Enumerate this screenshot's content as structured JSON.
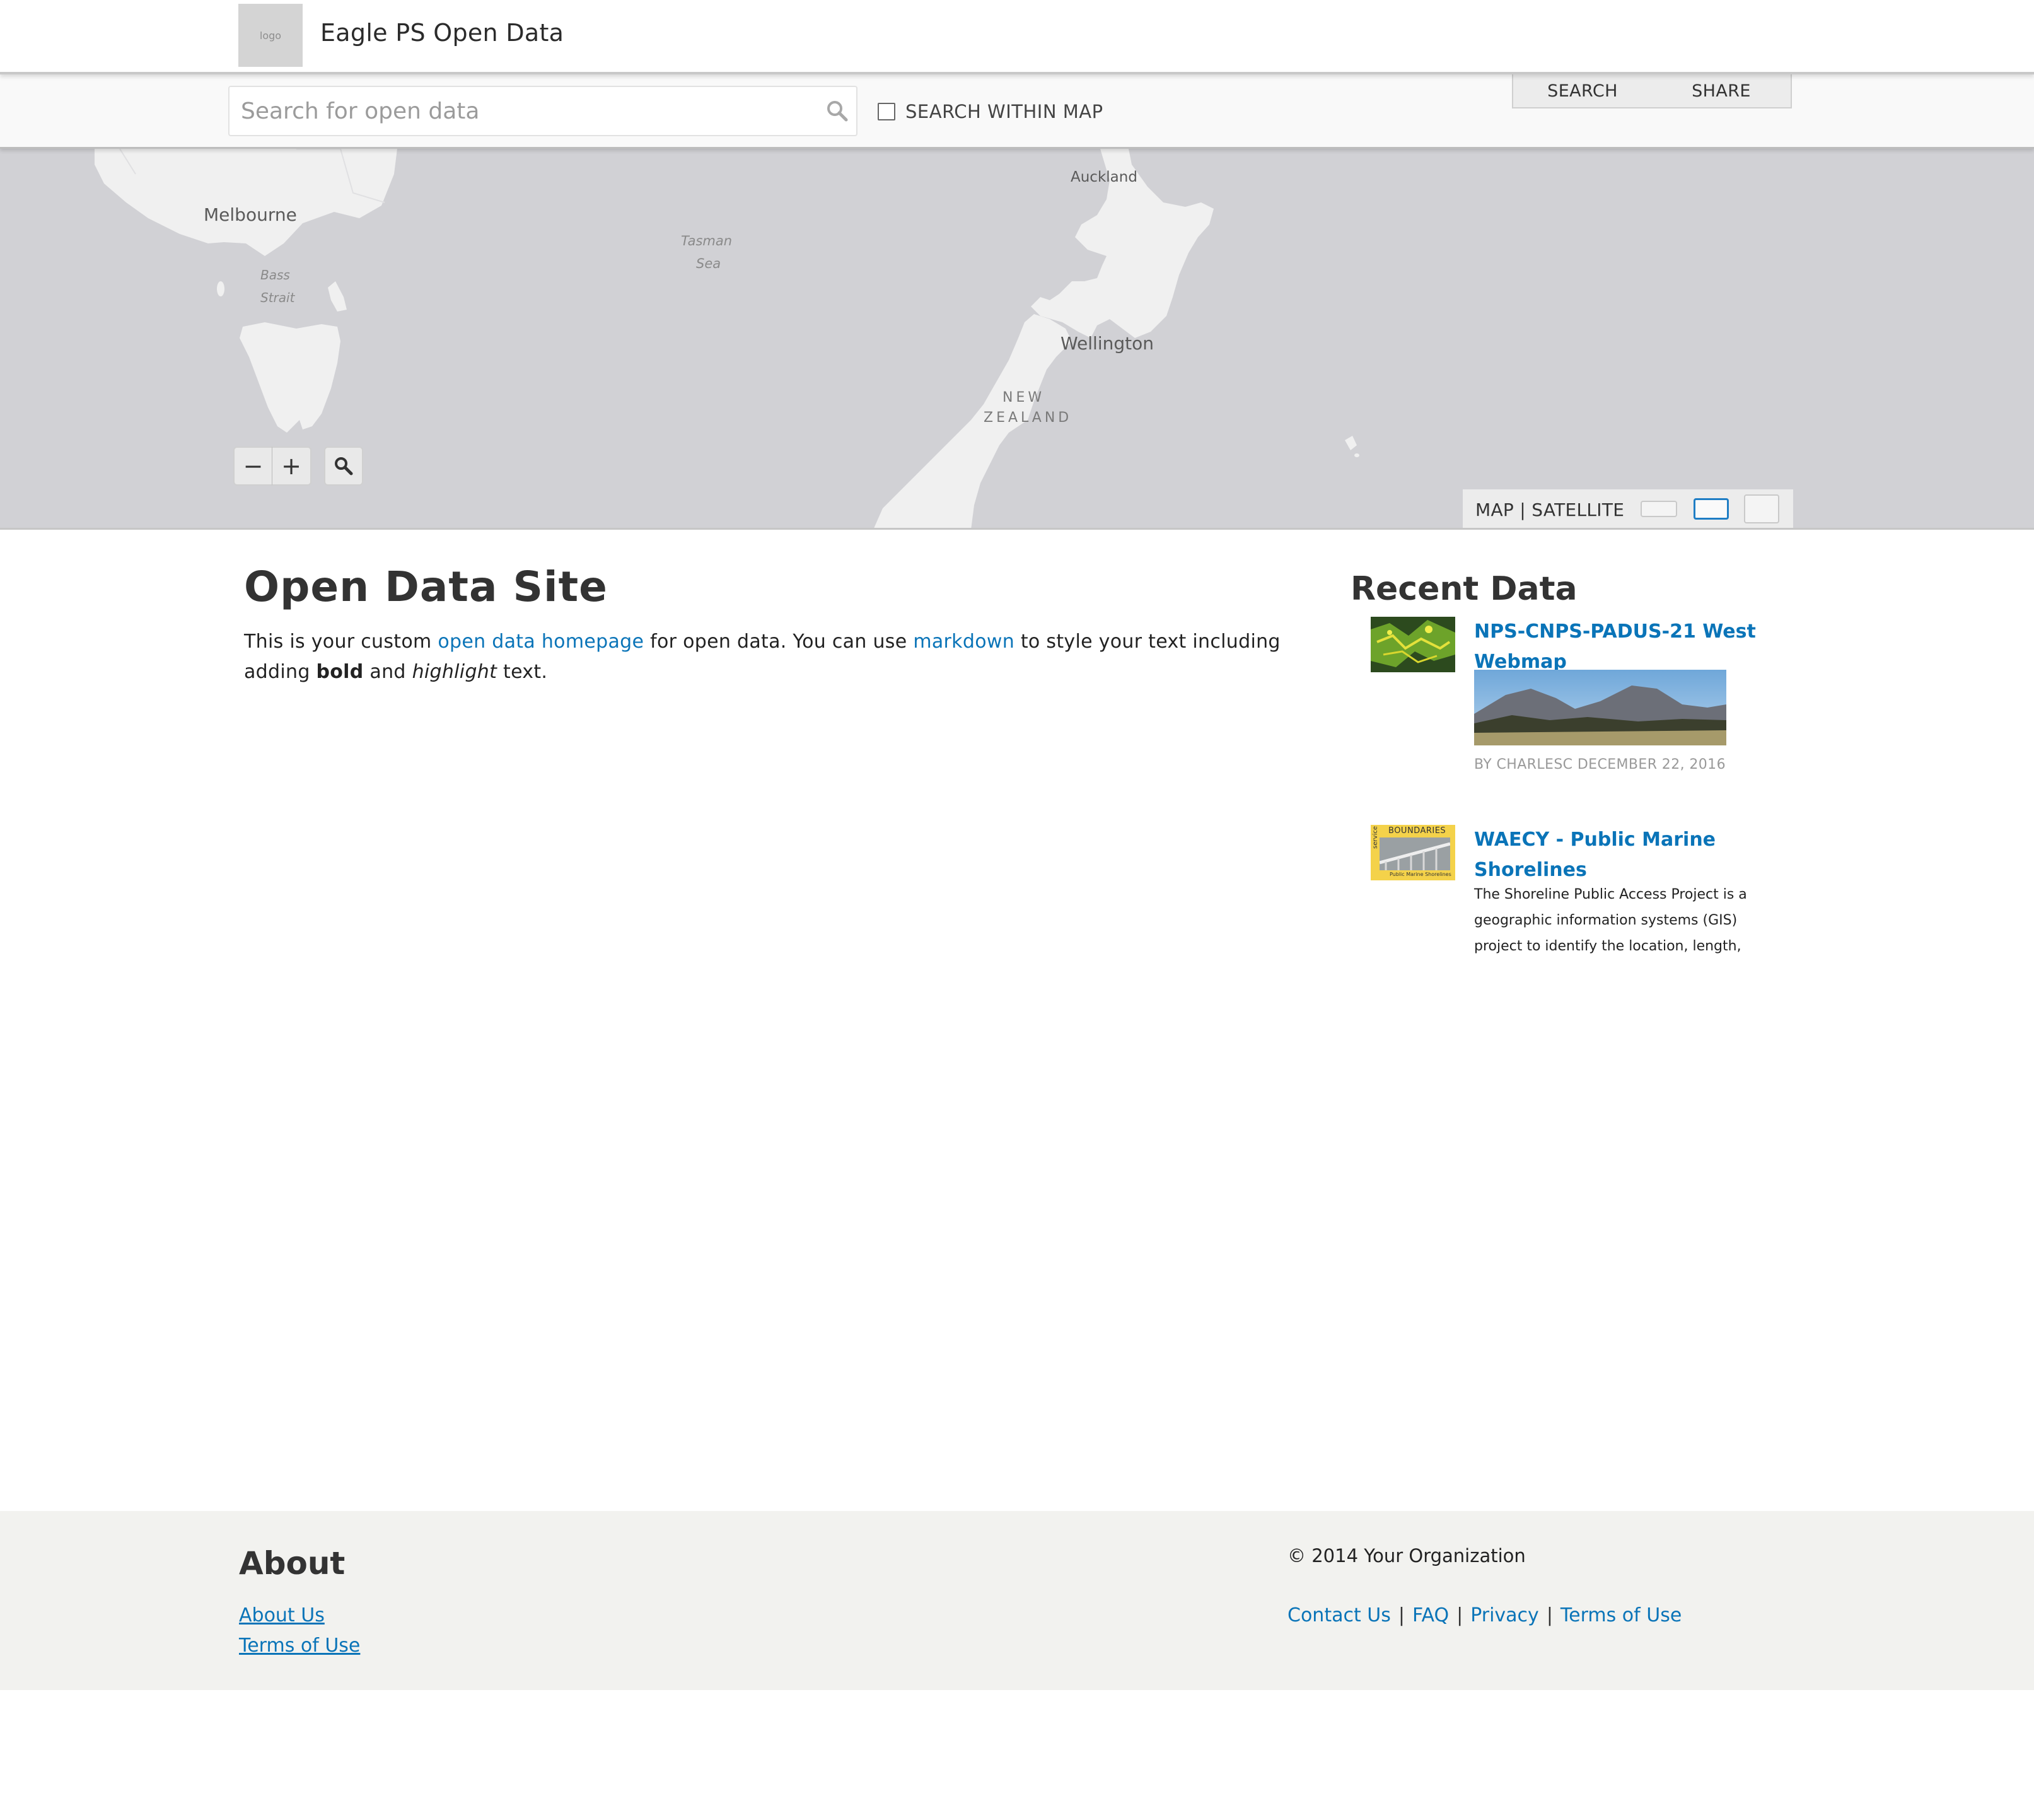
{
  "header": {
    "logo_text": "logo",
    "site_title": "Eagle PS Open Data"
  },
  "search": {
    "placeholder": "Search for open data",
    "within_map_label": "SEARCH WITHIN MAP",
    "tabs": [
      "SEARCH",
      "SHARE"
    ]
  },
  "map": {
    "labels": {
      "melbourne": "Melbourne",
      "bass_strait_1": "Bass",
      "bass_strait_2": "Strait",
      "tasman_1": "Tasman",
      "tasman_2": "Sea",
      "auckland": "Auckland",
      "wellington": "Wellington",
      "nz_1": "NEW",
      "nz_2": "ZEALAND"
    },
    "zoom_out": "−",
    "zoom_in": "+",
    "basemap_label": "MAP | SATELLITE",
    "colors": {
      "water": "#d1d1d5",
      "land": "#f0f0f0"
    }
  },
  "main": {
    "title": "Open Data Site",
    "intro": {
      "part1": "This is your custom ",
      "link1": "open data homepage",
      "part2": " for open data. You can use ",
      "link2": "markdown",
      "part3": " to style your text including adding ",
      "bold": "bold",
      "part4": " and ",
      "italic": "highlight",
      "part5": " text."
    }
  },
  "recent": {
    "title": "Recent Data",
    "items": [
      {
        "title": "NPS-CNPS-PADUS-21 West Webmap",
        "byline": "BY CHARLESC DECEMBER 22, 2016"
      },
      {
        "title": "WAECY - Public Marine Shorelines",
        "thumb_text": "BOUNDARIES",
        "thumb_side": "service",
        "thumb_caption": "Public Marine Shorelines",
        "desc_lines": [
          "The Shoreline Public Access Project is a",
          "geographic information systems (GIS)",
          "project to identify the location, length,"
        ]
      }
    ]
  },
  "footer": {
    "about_title": "About",
    "links": [
      "About Us",
      "Terms of Use"
    ],
    "copyright": "© 2014 Your Organization",
    "nav": [
      "Contact Us",
      "FAQ",
      "Privacy",
      "Terms of Use"
    ]
  }
}
